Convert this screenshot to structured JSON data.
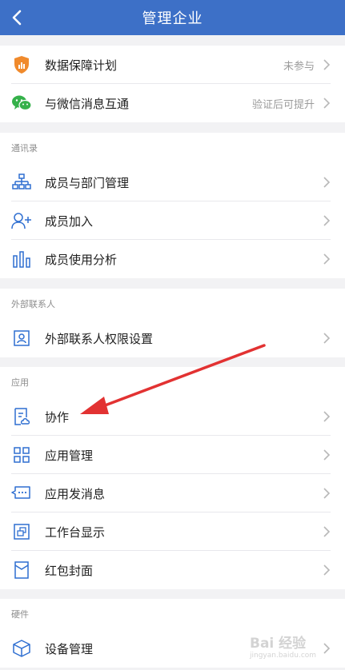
{
  "header": {
    "title": "管理企业",
    "back_icon": "chevron-left-icon"
  },
  "colors": {
    "brand": "#3d70c7",
    "icon_blue": "#2f6fd1",
    "arrow_red": "#e23232"
  },
  "top": {
    "items": [
      {
        "label": "数据保障计划",
        "value": "未参与",
        "icon": "shield-icon"
      },
      {
        "label": "与微信消息互通",
        "value": "验证后可提升",
        "icon": "wechat-icon"
      }
    ]
  },
  "contacts": {
    "title": "通讯录",
    "items": [
      {
        "label": "成员与部门管理",
        "icon": "org-chart-icon"
      },
      {
        "label": "成员加入",
        "icon": "add-user-icon"
      },
      {
        "label": "成员使用分析",
        "icon": "bar-chart-icon"
      }
    ]
  },
  "external": {
    "title": "外部联系人",
    "items": [
      {
        "label": "外部联系人权限设置",
        "icon": "contact-card-icon"
      }
    ]
  },
  "apps": {
    "title": "应用",
    "items": [
      {
        "label": "协作",
        "icon": "doc-cloud-icon"
      },
      {
        "label": "应用管理",
        "icon": "grid-icon"
      },
      {
        "label": "应用发消息",
        "icon": "chat-bubble-icon"
      },
      {
        "label": "工作台显示",
        "icon": "window-icon"
      },
      {
        "label": "红包封面",
        "icon": "envelope-icon"
      }
    ]
  },
  "hardware": {
    "title": "硬件",
    "items": [
      {
        "label": "设备管理",
        "icon": "box-icon"
      }
    ]
  },
  "watermark": {
    "text": "Bai 经验",
    "sub": "jingyan.baidu.com"
  }
}
